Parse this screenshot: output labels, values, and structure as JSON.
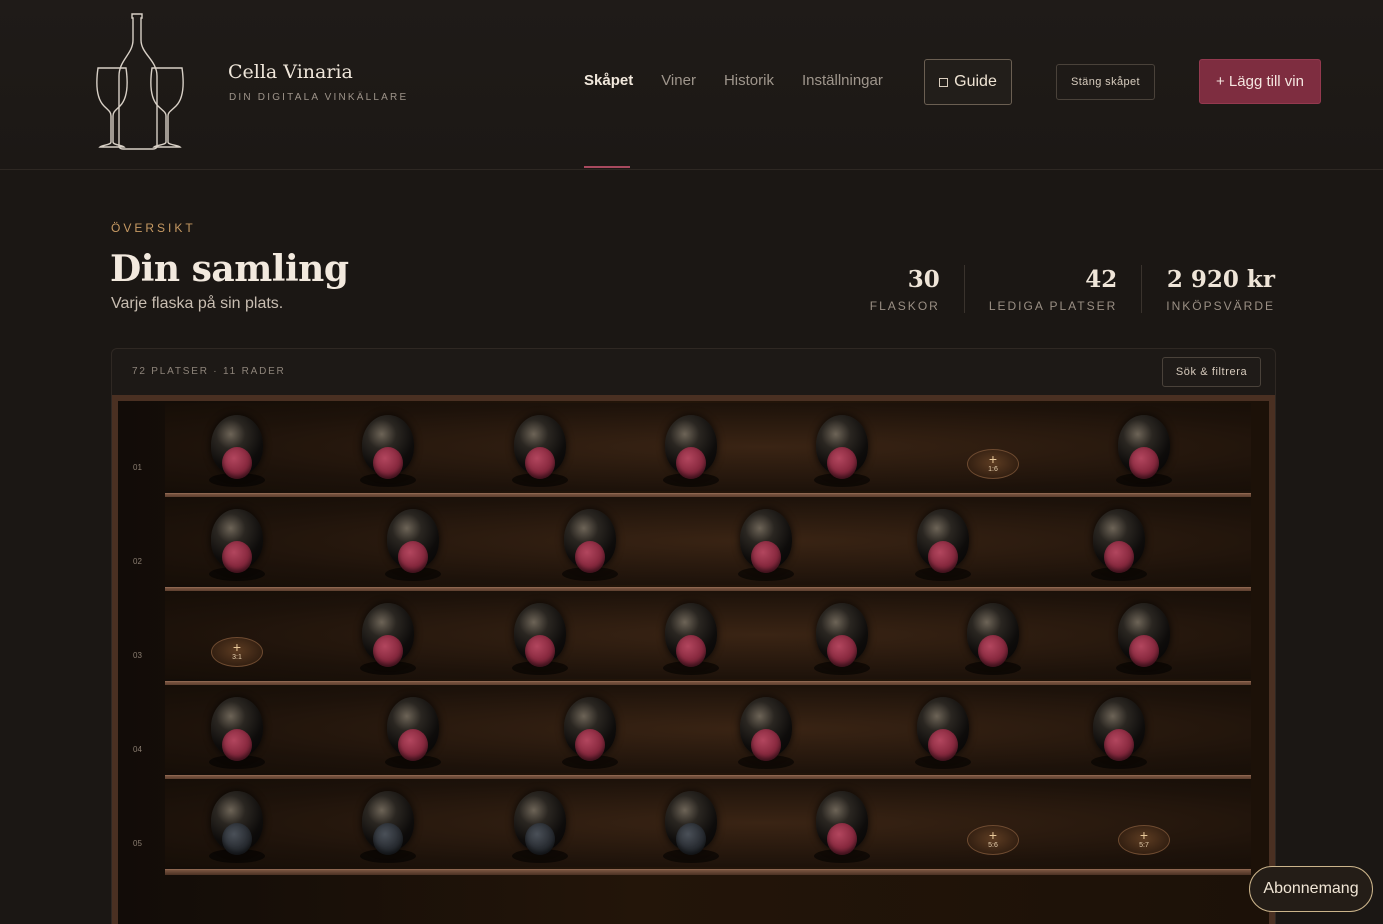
{
  "header": {
    "brand_name": "Cella Vinaria",
    "brand_tagline": "DIN DIGITALA VINKÄLLARE",
    "nav": [
      {
        "label": "Skåpet",
        "active": true
      },
      {
        "label": "Viner",
        "active": false
      },
      {
        "label": "Historik",
        "active": false
      },
      {
        "label": "Inställningar",
        "active": false
      }
    ],
    "guide_label": "Guide",
    "close_label": "Stäng skåpet",
    "add_label": "+ Lägg till vin"
  },
  "overview": {
    "eyebrow": "ÖVERSIKT",
    "title": "Din samling",
    "subtitle": "Varje flaska på sin plats.",
    "stats": [
      {
        "value": "30",
        "label": "FLASKOR"
      },
      {
        "value": "42",
        "label": "LEDIGA PLATSER"
      },
      {
        "value": "2 920 kr",
        "label": "INKÖPSVÄRDE"
      }
    ]
  },
  "cabinet": {
    "meta": "72 PLATSER · 11 RADER",
    "search_label": "Sök & filtrera",
    "rows": [
      {
        "label": "01",
        "slots": [
          {
            "type": "bottle",
            "cap": "red"
          },
          {
            "type": "bottle",
            "cap": "red"
          },
          {
            "type": "bottle",
            "cap": "red"
          },
          {
            "type": "bottle",
            "cap": "red"
          },
          {
            "type": "bottle",
            "cap": "red"
          },
          {
            "type": "empty",
            "pos": "1:6"
          },
          {
            "type": "bottle",
            "cap": "red"
          }
        ]
      },
      {
        "label": "02",
        "slots": [
          {
            "type": "bottle",
            "cap": "red"
          },
          {
            "type": "bottle",
            "cap": "red"
          },
          {
            "type": "bottle",
            "cap": "red"
          },
          {
            "type": "bottle",
            "cap": "red"
          },
          {
            "type": "bottle",
            "cap": "red"
          },
          {
            "type": "bottle",
            "cap": "red"
          }
        ]
      },
      {
        "label": "03",
        "slots": [
          {
            "type": "empty",
            "pos": "3:1"
          },
          {
            "type": "bottle",
            "cap": "red"
          },
          {
            "type": "bottle",
            "cap": "red"
          },
          {
            "type": "bottle",
            "cap": "red"
          },
          {
            "type": "bottle",
            "cap": "red"
          },
          {
            "type": "bottle",
            "cap": "red"
          },
          {
            "type": "bottle",
            "cap": "red"
          }
        ]
      },
      {
        "label": "04",
        "slots": [
          {
            "type": "bottle",
            "cap": "red"
          },
          {
            "type": "bottle",
            "cap": "red"
          },
          {
            "type": "bottle",
            "cap": "red"
          },
          {
            "type": "bottle",
            "cap": "red"
          },
          {
            "type": "bottle",
            "cap": "red"
          },
          {
            "type": "bottle",
            "cap": "red"
          }
        ]
      },
      {
        "label": "05",
        "slots": [
          {
            "type": "bottle",
            "cap": "dark"
          },
          {
            "type": "bottle",
            "cap": "dark"
          },
          {
            "type": "bottle",
            "cap": "dark"
          },
          {
            "type": "bottle",
            "cap": "dark"
          },
          {
            "type": "bottle",
            "cap": "red"
          },
          {
            "type": "empty",
            "pos": "5:6"
          },
          {
            "type": "empty",
            "pos": "5:7"
          }
        ]
      }
    ]
  },
  "subscription_label": "Abonnemang",
  "colors": {
    "accent": "#7e2d40",
    "gold": "#c79a63",
    "background": "#1b1714"
  }
}
